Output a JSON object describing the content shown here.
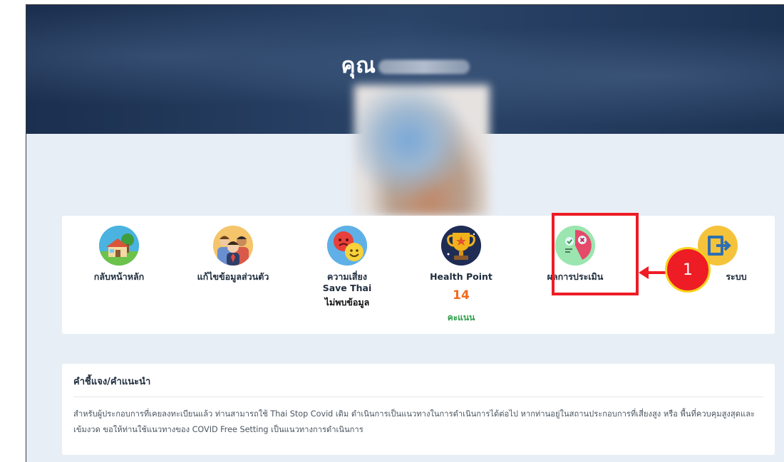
{
  "header": {
    "title_prefix": "คุณ"
  },
  "menu": {
    "home": {
      "label": "กลับหน้าหลัก",
      "icon": "house-icon"
    },
    "edit_profile": {
      "label": "แก้ไขข้อมูลส่วนตัว",
      "icon": "people-icon"
    },
    "risk": {
      "label_line1": "ความเสี่ยง",
      "label_line2": "Save Thai",
      "status": "ไม่พบข้อมูล",
      "icon": "emotion-faces-icon"
    },
    "health_point": {
      "label": "Health Point",
      "value": "14",
      "unit": "คะแนน",
      "icon": "trophy-icon"
    },
    "assessment": {
      "label": "ผลการประเมิน",
      "icon": "assessment-result-icon"
    },
    "logout": {
      "label": "ระบบ",
      "icon": "logout-icon"
    }
  },
  "annotation": {
    "callout_number": "1",
    "color": "#ee1c25"
  },
  "info": {
    "title": "คำชี้แจง/คำแนะนำ",
    "body": "สำหรับผู้ประกอบการที่เคยลงทะเบียนแล้ว ท่านสามารถใช้ Thai Stop Covid เดิม ดำเนินการเป็นแนวทางในการดำเนินการได้ต่อไป หากท่านอยู่ในสถานประกอบการที่เสี่ยงสูง หรือ พื้นที่ควบคุมสูงสุดและเข้มงวด ขอให้ท่านใช้แนวทางของ COVID Free Setting เป็นแนวทางการดำเนินการ"
  }
}
